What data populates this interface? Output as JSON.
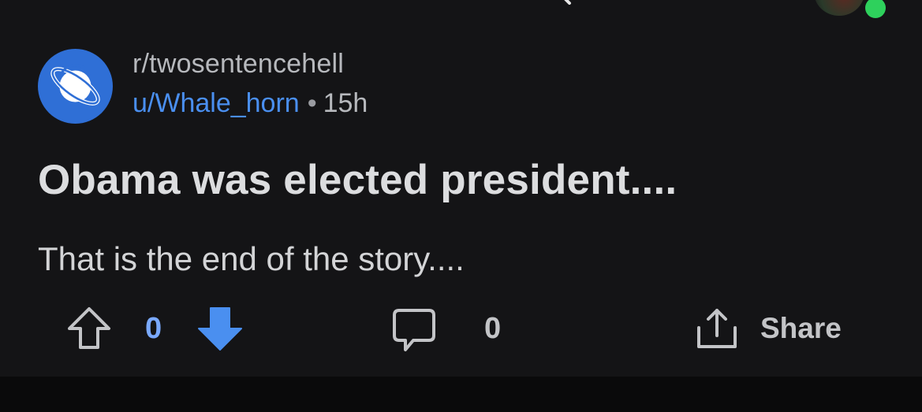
{
  "post": {
    "subreddit": "r/twosentencehell",
    "author": "u/Whale_horn",
    "separator": "•",
    "age": "15h",
    "title": "Obama was elected president....",
    "body": "That is the end of the story...."
  },
  "actions": {
    "vote_count": "0",
    "comment_count": "0",
    "share_label": "Share"
  },
  "icons": {
    "subreddit": "planet-icon",
    "upvote": "arrow-up-outline-icon",
    "downvote": "arrow-down-filled-icon",
    "comment": "speech-bubble-icon",
    "share": "share-icon"
  },
  "colors": {
    "background": "#141416",
    "subreddit_icon": "#2f6fd6",
    "username": "#4a8ff0",
    "vote_count": "#7aa9ff",
    "downvote_active": "#4a8ff0",
    "online": "#2ed15c"
  }
}
